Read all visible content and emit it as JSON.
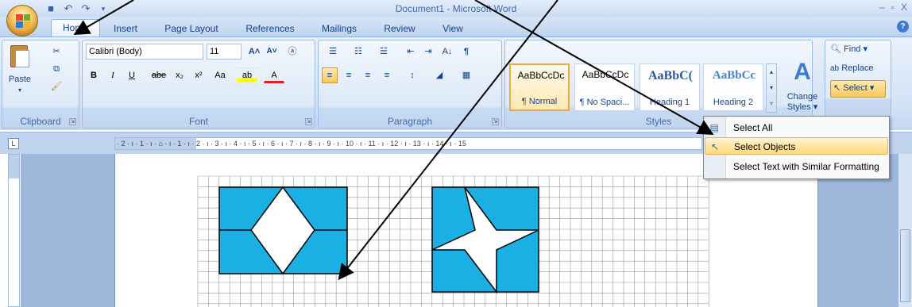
{
  "window": {
    "title": "Document1 - Microsoft Word",
    "min": "–",
    "max": "▫",
    "close": "X"
  },
  "qat": {
    "save": "💾",
    "undo": "↶",
    "redo": "↷",
    "more": "⯆"
  },
  "tabs": [
    {
      "label": "Home",
      "active": true
    },
    {
      "label": "Insert"
    },
    {
      "label": "Page Layout"
    },
    {
      "label": "References"
    },
    {
      "label": "Mailings"
    },
    {
      "label": "Review"
    },
    {
      "label": "View"
    }
  ],
  "help": "?",
  "clipboard": {
    "label": "Clipboard",
    "paste": "Paste",
    "launcher": "⇲"
  },
  "font": {
    "label": "Font",
    "name": "Calibri (Body)",
    "size": "11",
    "grow": "A˄",
    "shrink": "A˅",
    "clear": "ⓐ",
    "bold": "B",
    "italic": "I",
    "underline": "U",
    "strike": "abe",
    "sub": "x₂",
    "sup": "x²",
    "case": "Aa",
    "highlight": "ab",
    "color": "A",
    "launcher": "⇲"
  },
  "paragraph": {
    "label": "Paragraph",
    "bullets": "☰",
    "numbering": "☷",
    "multilevel": "☱",
    "decindent": "⇤",
    "incindent": "⇥",
    "sort": "A↓",
    "pilcrow": "¶",
    "left": "≡",
    "center": "≡",
    "right": "≡",
    "justify": "≡",
    "spacing": "↕",
    "shading": "◢",
    "borders": "▦",
    "launcher": "⇲"
  },
  "styles": {
    "label": "Styles",
    "tiles": [
      {
        "sample": "AaBbCcDc",
        "name": "¶ Normal",
        "selected": true
      },
      {
        "sample": "AaBbCcDc",
        "name": "¶ No Spaci..."
      },
      {
        "sample": "AaBbC(",
        "name": "Heading 1"
      },
      {
        "sample": "AaBbCc",
        "name": "Heading 2"
      }
    ],
    "change": "Change Styles ▾",
    "change_line1": "Change",
    "change_line2": "Styles ▾",
    "launcher": "⇲"
  },
  "editing": {
    "find": "Find ▾",
    "replace": "Replace",
    "select": "Select ▾"
  },
  "ruler": {
    "corner": "L",
    "marks": "· 2 · ı · 1 · ı · ⌂ · ı · 1 · ı · 2 · ı · 3 · ı · 4 · ı · 5 · ı · 6 · ı · 7 · ı · 8 · ı · 9 · ı · 10 · ı · 11 · ı · 12 · ı · 13 · ı · 14 · ı · 15"
  },
  "menu": {
    "items": [
      {
        "label": "Select All",
        "icon": "select-all-icon",
        "glyph": "▤"
      },
      {
        "label": "Select Objects",
        "icon": "pointer-icon",
        "glyph": "↖",
        "highlighted": true
      },
      {
        "label": "Select Text with Similar Formatting",
        "icon": "",
        "glyph": ""
      }
    ]
  },
  "colors": {
    "shape_fill": "#1bb0e4",
    "grid": "#9a9a9a",
    "accent": "#f9c75d"
  }
}
